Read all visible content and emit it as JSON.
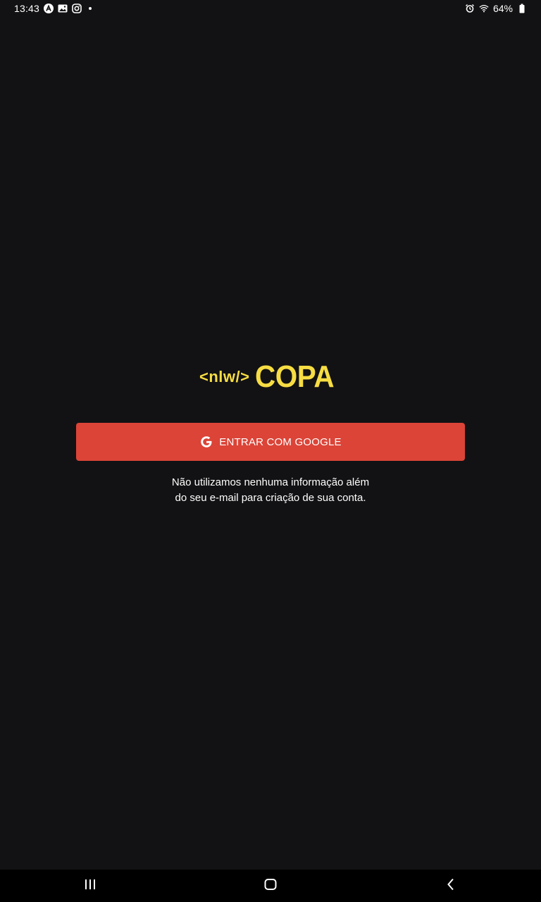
{
  "status_bar": {
    "time": "13:43",
    "left_icons": [
      "a-circle-icon",
      "image-icon",
      "instagram-icon"
    ],
    "right_icons": [
      "alarm-icon",
      "wifi-icon",
      "battery-icon"
    ],
    "battery": "64%"
  },
  "logo": {
    "code_text": "<nlw/>",
    "brand_text": "COPA",
    "color": "#F7DD43"
  },
  "login": {
    "button_label": "ENTRAR COM GOOGLE",
    "button_color": "#DB4437",
    "button_icon": "google-icon",
    "disclaimer_line1": "Não utilizamos nenhuma informação além",
    "disclaimer_line2": "do seu e-mail para criação de sua conta."
  },
  "nav_bar": {
    "buttons": [
      "recents-icon",
      "home-icon",
      "back-icon"
    ]
  },
  "colors": {
    "background": "#121214",
    "nav_background": "#000000"
  }
}
